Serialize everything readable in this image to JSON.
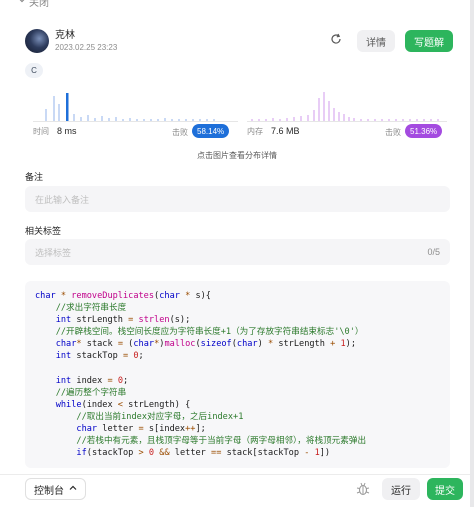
{
  "topbar": {
    "close_label": "关闭"
  },
  "header": {
    "username": "克林",
    "timestamp": "2023.02.25 23:23",
    "refresh_icon": "refresh-icon",
    "details_label": "详情",
    "write_solution_label": "写题解"
  },
  "language": "C",
  "stats": {
    "time_label": "时间",
    "time_value": "8 ms",
    "time_beat_label": "击败",
    "time_beat_value": "58.14%",
    "memory_label": "内存",
    "memory_value": "7.6 MB",
    "memory_beat_label": "击败",
    "memory_beat_value": "51.36%",
    "hint": "点击图片查看分布详情"
  },
  "colors": {
    "accent_green": "#2db55d",
    "time_blue": "#1e6fd9",
    "time_bar_light": "#c9d9f5",
    "memory_purple": "#a44be0",
    "memory_bar_light": "#e8cdf6"
  },
  "notes": {
    "label": "备注",
    "placeholder": "在此输入备注"
  },
  "tags": {
    "label": "相关标签",
    "placeholder": "选择标签",
    "counter": "0/5"
  },
  "code": [
    [
      [
        "kw",
        "char"
      ],
      [
        "op",
        " * "
      ],
      [
        "fn",
        "removeDuplicates"
      ],
      [
        "id",
        "("
      ],
      [
        "kw",
        "char"
      ],
      [
        "op",
        " * "
      ],
      [
        "id",
        "s){"
      ]
    ],
    [
      [
        "id",
        "    "
      ],
      [
        "cm",
        "//求出字符串长度"
      ]
    ],
    [
      [
        "id",
        "    "
      ],
      [
        "kw",
        "int"
      ],
      [
        "id",
        " strLength "
      ],
      [
        "op",
        "="
      ],
      [
        "id",
        " "
      ],
      [
        "fn",
        "strlen"
      ],
      [
        "id",
        "(s);"
      ]
    ],
    [
      [
        "id",
        "    "
      ],
      [
        "cm",
        "//开辟栈空间。栈空间长度应为字符串长度+1（为了存放字符串结束标志'\\0'）"
      ]
    ],
    [
      [
        "id",
        "    "
      ],
      [
        "kw",
        "char"
      ],
      [
        "op",
        "*"
      ],
      [
        "id",
        " stack "
      ],
      [
        "op",
        "="
      ],
      [
        "id",
        " ("
      ],
      [
        "kw",
        "char"
      ],
      [
        "op",
        "*"
      ],
      [
        "id",
        ")"
      ],
      [
        "fn",
        "malloc"
      ],
      [
        "id",
        "("
      ],
      [
        "kw",
        "sizeof"
      ],
      [
        "id",
        "("
      ],
      [
        "kw",
        "char"
      ],
      [
        "id",
        ") "
      ],
      [
        "op",
        "*"
      ],
      [
        "id",
        " strLength "
      ],
      [
        "op",
        "+"
      ],
      [
        "id",
        " "
      ],
      [
        "nm",
        "1"
      ],
      [
        "id",
        ");"
      ]
    ],
    [
      [
        "id",
        "    "
      ],
      [
        "kw",
        "int"
      ],
      [
        "id",
        " stackTop "
      ],
      [
        "op",
        "="
      ],
      [
        "id",
        " "
      ],
      [
        "nm",
        "0"
      ],
      [
        "id",
        ";"
      ]
    ],
    [
      [
        "id",
        ""
      ]
    ],
    [
      [
        "id",
        "    "
      ],
      [
        "kw",
        "int"
      ],
      [
        "id",
        " index "
      ],
      [
        "op",
        "="
      ],
      [
        "id",
        " "
      ],
      [
        "nm",
        "0"
      ],
      [
        "id",
        ";"
      ]
    ],
    [
      [
        "id",
        "    "
      ],
      [
        "cm",
        "//遍历整个字符串"
      ]
    ],
    [
      [
        "id",
        "    "
      ],
      [
        "kw",
        "while"
      ],
      [
        "id",
        "(index "
      ],
      [
        "op",
        "<"
      ],
      [
        "id",
        " strLength) {"
      ]
    ],
    [
      [
        "id",
        "        "
      ],
      [
        "cm",
        "//取出当前index对应字母，之后index+1"
      ]
    ],
    [
      [
        "id",
        "        "
      ],
      [
        "kw",
        "char"
      ],
      [
        "id",
        " letter "
      ],
      [
        "op",
        "="
      ],
      [
        "id",
        " s[index"
      ],
      [
        "op",
        "++"
      ],
      [
        "id",
        "];"
      ]
    ],
    [
      [
        "id",
        "        "
      ],
      [
        "cm",
        "//若栈中有元素，且栈顶字母等于当前字母（两字母相邻），将栈顶元素弹出"
      ]
    ],
    [
      [
        "id",
        "        "
      ],
      [
        "kw",
        "if"
      ],
      [
        "id",
        "(stackTop "
      ],
      [
        "op",
        ">"
      ],
      [
        "id",
        " "
      ],
      [
        "nm",
        "0"
      ],
      [
        "id",
        " "
      ],
      [
        "op",
        "&&"
      ],
      [
        "id",
        " letter "
      ],
      [
        "op",
        "=="
      ],
      [
        "id",
        " stack[stackTop "
      ],
      [
        "op",
        "-"
      ],
      [
        "id",
        " "
      ],
      [
        "nm",
        "1"
      ],
      [
        "id",
        "])"
      ]
    ]
  ],
  "bottombar": {
    "console_label": "控制台",
    "run_label": "运行",
    "submit_label": "提交"
  }
}
